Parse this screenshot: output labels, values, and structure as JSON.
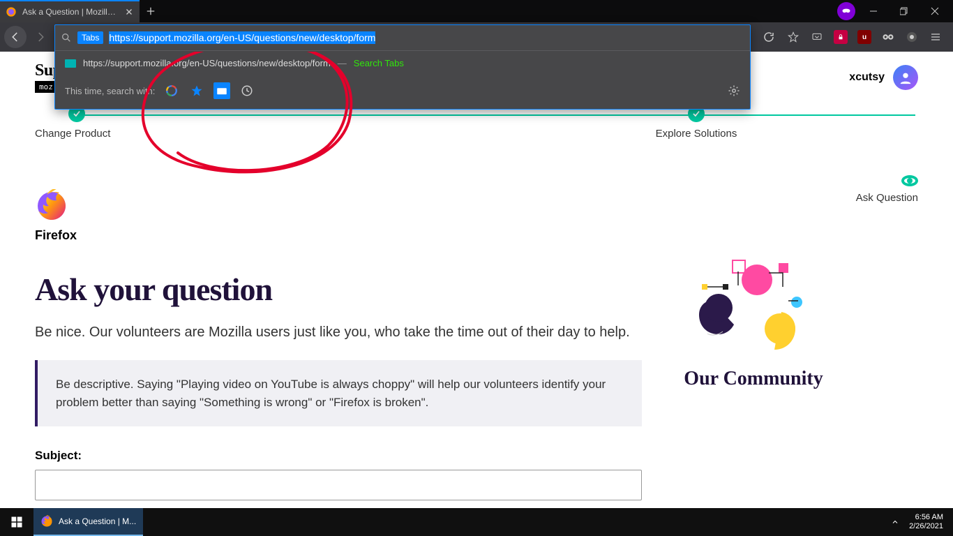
{
  "browser": {
    "tab_title": "Ask a Question | Mozilla Suppo",
    "url": "https://support.mozilla.org/en-US/questions/new/desktop/form",
    "urlbar_chip": "Tabs",
    "suggestion_url": "https://support.mozilla.org/en-US/questions/new/desktop/form",
    "suggestion_action": "Search Tabs",
    "search_with_label": "This time, search with:"
  },
  "page": {
    "brand_top": "Support",
    "brand_bottom": "moz://a",
    "username": "xcutsy",
    "steps": {
      "s1": "Change Product",
      "s2": "Explore Solutions",
      "s3": "Ask Question"
    },
    "product_name": "Firefox",
    "heading": "Ask your question",
    "subtitle": "Be nice. Our volunteers are Mozilla users just like you, who take the time out of their day to help.",
    "callout": "Be descriptive. Saying \"Playing video on YouTube is always choppy\" will help our volunteers identify your problem better than saying \"Something is wrong\" or \"Firefox is broken\".",
    "subject_label": "Subject:",
    "community_title": "Our Community"
  },
  "taskbar": {
    "app_label": "Ask a Question | M...",
    "time": "6:56 AM",
    "date": "2/26/2021"
  }
}
